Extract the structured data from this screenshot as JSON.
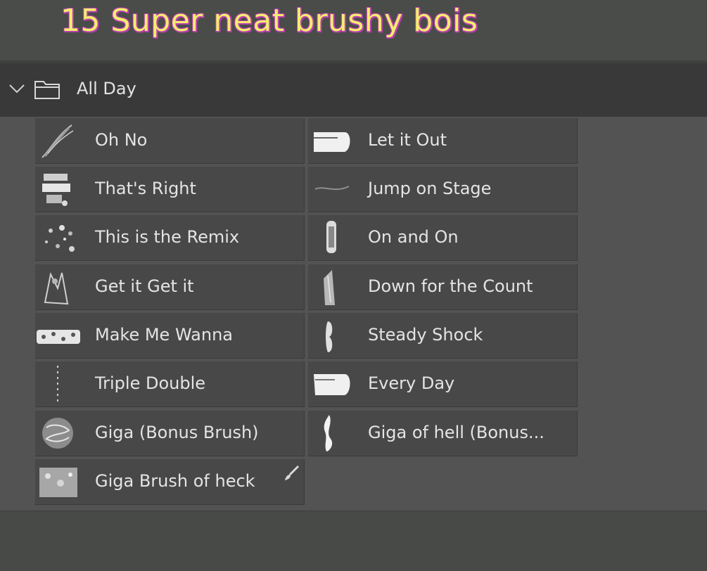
{
  "banner": {
    "title": "15 Super neat brushy bois"
  },
  "group": {
    "label": "All Day"
  },
  "brushes": [
    {
      "label": "Oh No"
    },
    {
      "label": "Let it Out"
    },
    {
      "label": "That's Right"
    },
    {
      "label": "Jump on Stage"
    },
    {
      "label": "This is the Remix"
    },
    {
      "label": "On and On"
    },
    {
      "label": "Get it Get it"
    },
    {
      "label": "Down for the Count"
    },
    {
      "label": "Make Me Wanna"
    },
    {
      "label": "Steady Shock"
    },
    {
      "label": "Triple Double"
    },
    {
      "label": "Every Day"
    },
    {
      "label": "Giga (Bonus Brush)"
    },
    {
      "label": "Giga of hell (Bonus..."
    },
    {
      "label": "Giga Brush of heck"
    }
  ],
  "colors": {
    "title_fill": "#f4ec6e",
    "title_outline": "#b83fb0",
    "tile_bg": "#484848",
    "header_bg": "#393939"
  }
}
